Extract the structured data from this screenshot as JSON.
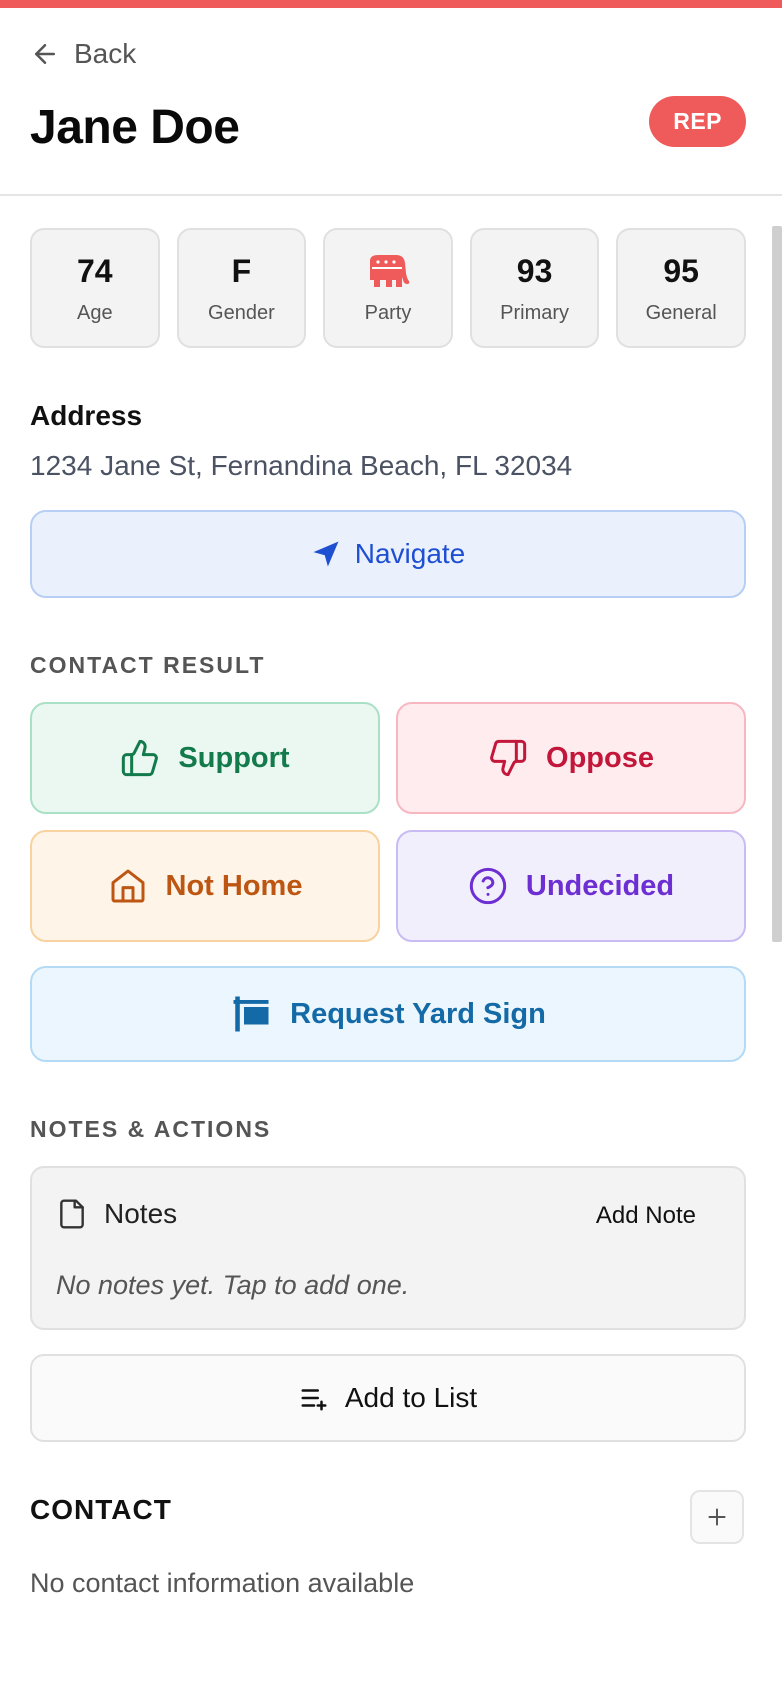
{
  "header": {
    "back_label": "Back",
    "name": "Jane Doe",
    "party_badge": "REP"
  },
  "stats": [
    {
      "value": "74",
      "label": "Age"
    },
    {
      "value": "F",
      "label": "Gender"
    },
    {
      "icon": "elephant-icon",
      "label": "Party"
    },
    {
      "value": "93",
      "label": "Primary"
    },
    {
      "value": "95",
      "label": "General"
    }
  ],
  "address": {
    "label": "Address",
    "value": "1234 Jane St, Fernandina Beach, FL 32034",
    "navigate_label": "Navigate"
  },
  "contact_result": {
    "heading": "CONTACT RESULT",
    "support": "Support",
    "oppose": "Oppose",
    "not_home": "Not Home",
    "undecided": "Undecided",
    "yard_sign": "Request Yard Sign"
  },
  "notes_actions": {
    "heading": "NOTES & ACTIONS",
    "notes_title": "Notes",
    "add_note": "Add Note",
    "empty": "No notes yet. Tap to add one.",
    "add_to_list": "Add to List"
  },
  "contact": {
    "heading": "CONTACT",
    "empty": "No contact information available"
  },
  "colors": {
    "accent": "#ef5b5b",
    "support": "#137a4b",
    "oppose": "#c2173a",
    "not_home": "#bd5513",
    "undecided": "#6d2fd2",
    "yard_sign": "#136aa6",
    "navigate": "#1f4fd1"
  }
}
